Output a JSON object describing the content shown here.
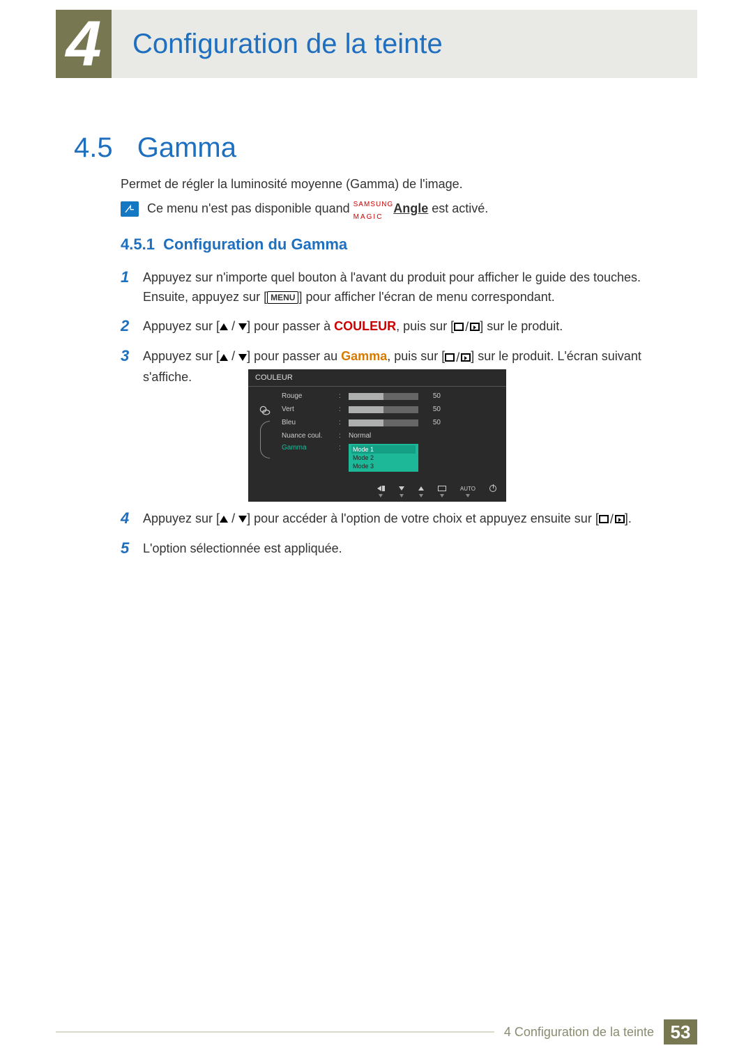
{
  "header": {
    "chapter_number": "4",
    "chapter_title": "Configuration de la teinte"
  },
  "section": {
    "number": "4.5",
    "title": "Gamma",
    "intro": "Permet de régler la luminosité moyenne (Gamma) de l'image.",
    "note_prefix": "Ce menu n'est pas disponible quand ",
    "note_brand_top": "SAMSUNG",
    "note_brand_bot": "MAGIC",
    "note_angle": "Angle",
    "note_suffix": " est activé."
  },
  "subsection": {
    "number": "4.5.1",
    "title": "Configuration du Gamma"
  },
  "steps": {
    "s1_a": "Appuyez sur n'importe quel bouton à l'avant du produit pour afficher le guide des touches. Ensuite, appuyez sur [",
    "s1_menu": "MENU",
    "s1_b": "] pour afficher l'écran de menu correspondant.",
    "s2_a": "Appuyez sur [",
    "s2_b": "] pour passer à ",
    "s2_hl": "COULEUR",
    "s2_c": ", puis sur [",
    "s2_d": "] sur le produit.",
    "s3_a": "Appuyez sur [",
    "s3_b": "] pour passer au ",
    "s3_hl": "Gamma",
    "s3_c": ", puis sur [",
    "s3_d": "] sur le produit. L'écran suivant s'affiche.",
    "s4_a": "Appuyez sur [",
    "s4_b": "] pour accéder à l'option de votre choix et appuyez ensuite sur [",
    "s4_c": "].",
    "s5": "L'option sélectionnée est appliquée."
  },
  "osd": {
    "title": "COULEUR",
    "rows": [
      {
        "label": "Rouge",
        "value": 50,
        "bar": 50
      },
      {
        "label": "Vert",
        "value": 50,
        "bar": 50
      },
      {
        "label": "Bleu",
        "value": 50,
        "bar": 50
      }
    ],
    "nuance_label": "Nuance coul.",
    "nuance_value": "Normal",
    "gamma_label": "Gamma",
    "gamma_options": [
      "Mode 1",
      "Mode 2",
      "Mode 3"
    ],
    "nav_auto": "AUTO"
  },
  "footer": {
    "text": "4 Configuration de la teinte",
    "page": "53"
  }
}
